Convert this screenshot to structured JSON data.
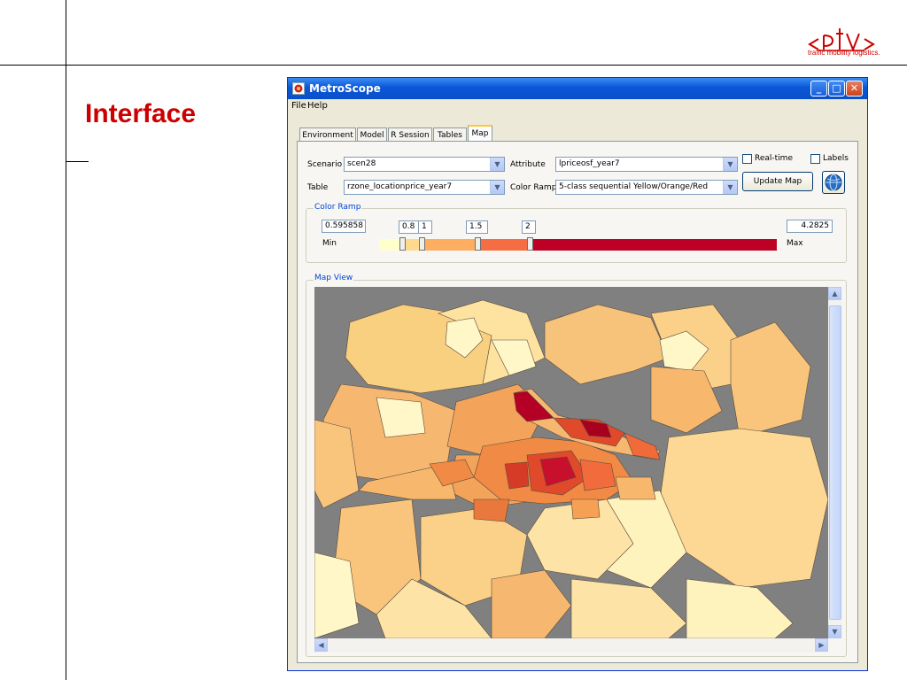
{
  "slide": {
    "title": "Interface",
    "logo": {
      "text": "ptv",
      "tagline": "traffic mobility logistics."
    }
  },
  "window": {
    "title": "MetroScope",
    "menu": [
      "File",
      "Help"
    ],
    "tabs": [
      {
        "label": "Environment",
        "active": false
      },
      {
        "label": "Model",
        "active": false
      },
      {
        "label": "R Session",
        "active": false
      },
      {
        "label": "Tables",
        "active": false
      },
      {
        "label": "Map",
        "active": true
      }
    ],
    "controls": {
      "scenario_label": "Scenario",
      "scenario_value": "scen28",
      "table_label": "Table",
      "table_value": "rzone_locationprice_year7",
      "attribute_label": "Attribute",
      "attribute_value": "lpriceosf_year7",
      "color_ramp_label": "Color Ramp",
      "color_ramp_value": "5-class sequential Yellow/Orange/Red",
      "realtime_label": "Real-time",
      "realtime_checked": false,
      "labels_label": "Labels",
      "labels_checked": false,
      "update_button": "Update Map",
      "globe_icon": "globe-icon"
    },
    "color_ramp_group": {
      "title": "Color Ramp",
      "min_value": "0.595858",
      "max_value": "4.2825",
      "min_label": "Min",
      "max_label": "Max",
      "breaks": [
        "0.8",
        "1",
        "1.5",
        "2"
      ],
      "colors": [
        "#ffffcc",
        "#fed98e",
        "#fdae61",
        "#f46d43",
        "#bd0026"
      ]
    },
    "map_view": {
      "title": "Map View"
    }
  }
}
